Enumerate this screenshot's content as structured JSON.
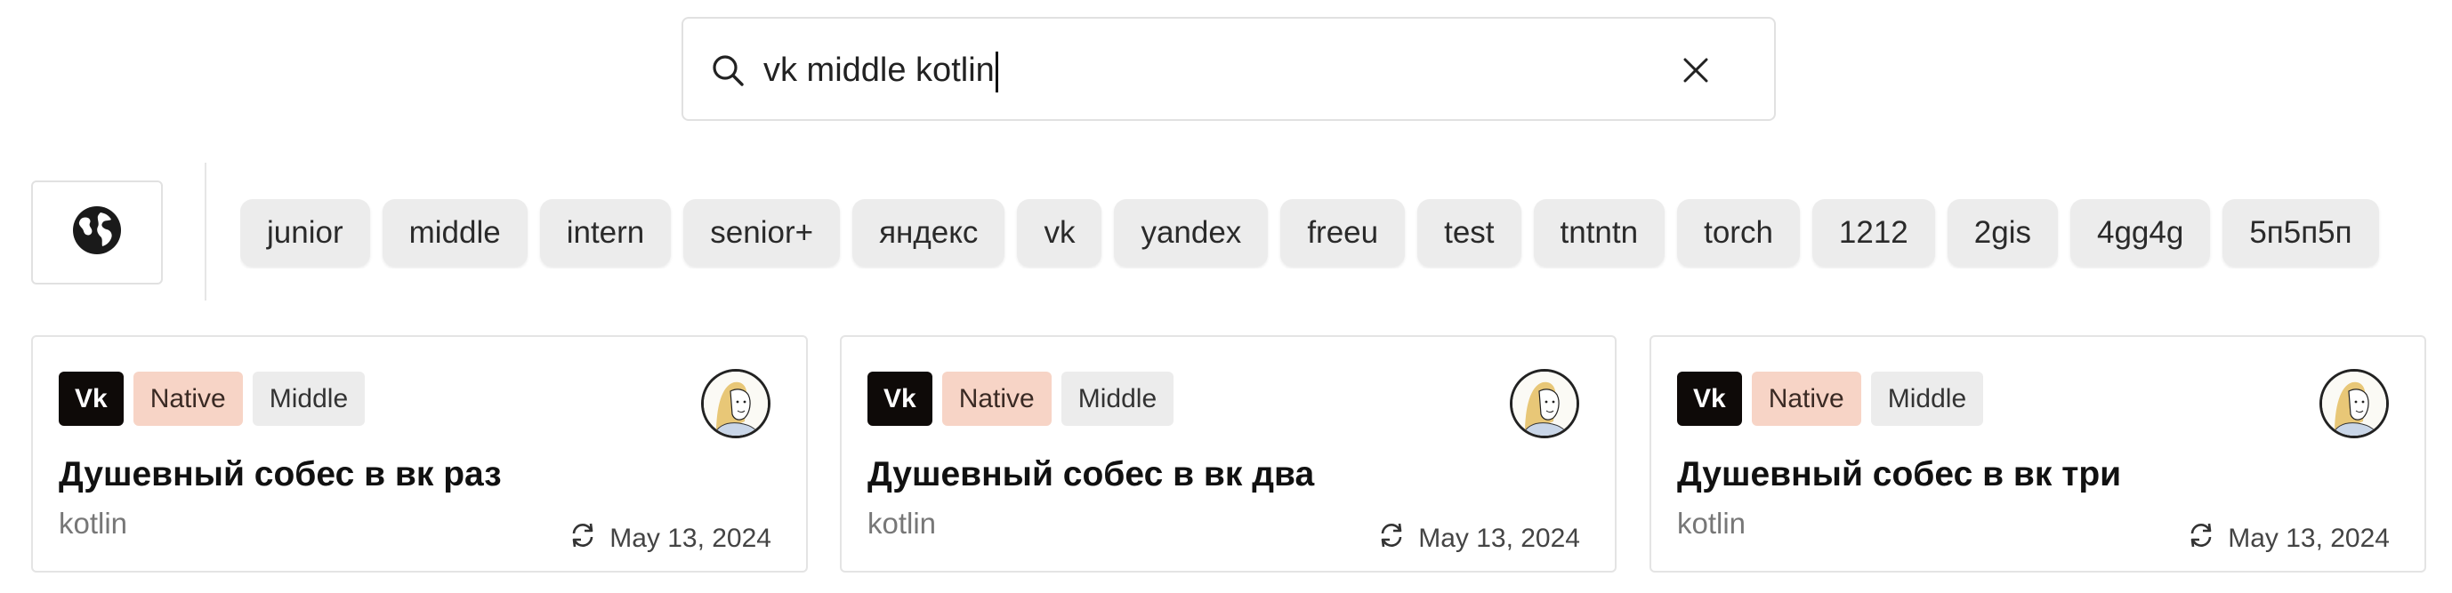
{
  "search": {
    "value": "vk middle kotlin",
    "icon": "search-icon",
    "clear_icon": "close-icon"
  },
  "filters": {
    "globe_icon": "globe-icon",
    "tags": [
      "junior",
      "middle",
      "intern",
      "senior+",
      "яндекс",
      "vk",
      "yandex",
      "freeu",
      "test",
      "tntntn",
      "torch",
      "1212",
      "2gis",
      "4gg4g",
      "5п5п5п"
    ]
  },
  "cards": [
    {
      "company": "Vk",
      "platform": "Native",
      "level": "Middle",
      "title": "Душевный собес в вк раз",
      "subtitle": "kotlin",
      "date": "May 13, 2024"
    },
    {
      "company": "Vk",
      "platform": "Native",
      "level": "Middle",
      "title": "Душевный собес в вк два",
      "subtitle": "kotlin",
      "date": "May 13, 2024"
    },
    {
      "company": "Vk",
      "platform": "Native",
      "level": "Middle",
      "title": "Душевный собес в вк три",
      "subtitle": "kotlin",
      "date": "May 13, 2024"
    }
  ],
  "colors": {
    "company_badge": "#0e0a08",
    "platform_badge": "#f7d4c6",
    "level_badge": "#ececec",
    "tag_bg": "#ececec",
    "border": "#e1e1e1"
  }
}
